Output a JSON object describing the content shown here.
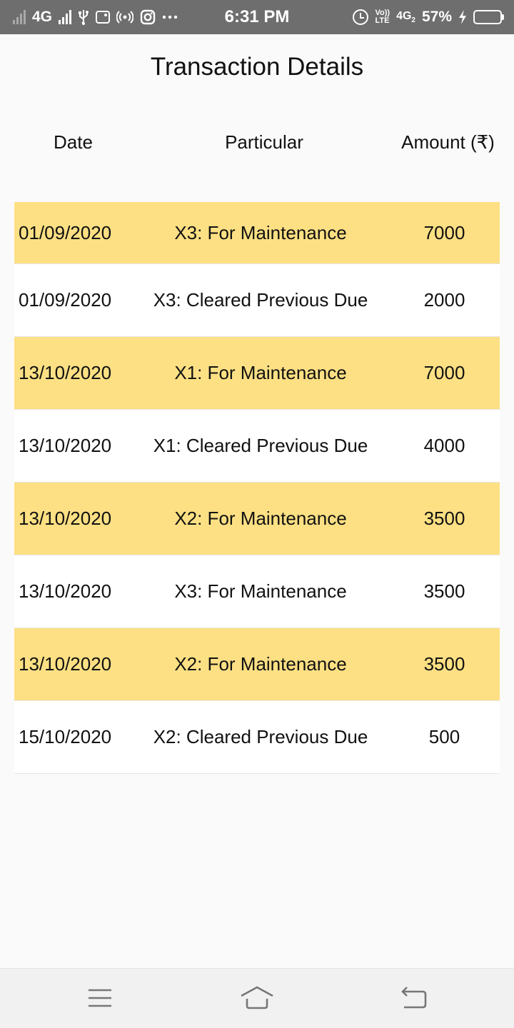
{
  "status_bar": {
    "network_left": "4G",
    "time": "6:31 PM",
    "volte_top": "Vo))",
    "volte_bottom": "LTE",
    "network_right": "4G",
    "network_right_sub": "2",
    "battery": "57%",
    "battery_level": 0.57
  },
  "page": {
    "title": "Transaction Details"
  },
  "table": {
    "columns": [
      "Date",
      "Particular",
      "Amount (₹)"
    ],
    "rows": [
      {
        "date": "01/09/2020",
        "particular": "X3: For Maintenance",
        "amount": "7000"
      },
      {
        "date": "01/09/2020",
        "particular": "X3: Cleared Previous Due",
        "amount": "2000"
      },
      {
        "date": "13/10/2020",
        "particular": "X1: For Maintenance",
        "amount": "7000"
      },
      {
        "date": "13/10/2020",
        "particular": "X1: Cleared Previous Due",
        "amount": "4000"
      },
      {
        "date": "13/10/2020",
        "particular": "X2: For Maintenance",
        "amount": "3500"
      },
      {
        "date": "13/10/2020",
        "particular": "X3: For Maintenance",
        "amount": "3500"
      },
      {
        "date": "13/10/2020",
        "particular": "X2: For Maintenance",
        "amount": "3500"
      },
      {
        "date": "15/10/2020",
        "particular": "X2: Cleared Previous Due",
        "amount": "500"
      }
    ]
  },
  "colors": {
    "status_bar": "#6e6e6e",
    "row_highlight": "#fde083",
    "row_plain": "#ffffff",
    "background": "#fafafa"
  },
  "nav_bar": {
    "icons": [
      "menu-icon",
      "home-icon",
      "back-icon"
    ]
  }
}
